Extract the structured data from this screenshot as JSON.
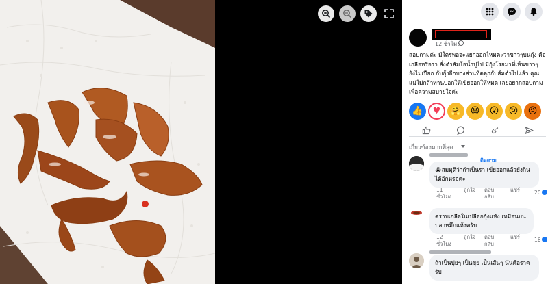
{
  "viewer": {
    "tools": [
      {
        "icon": "zoom-in-icon"
      },
      {
        "icon": "zoom-out-icon"
      },
      {
        "icon": "tag-icon"
      }
    ],
    "expand_icon": "expand-icon"
  },
  "topbar": {
    "icons": [
      "menu-grid-icon",
      "messenger-icon",
      "notifications-bell-icon"
    ]
  },
  "post": {
    "time": "12 ชั่วโมง",
    "caption": "สอบถามค่ะ มีใครพอจะแยกออกไหมคะว่าขาวๆบนกุ้ง คือเกลือหรือรา สั่งตำส้มโอน้ำปูไป มีกุ้งโรยมาที่เห็นขาวๆ ยังไม่เปียก กับกุ้งอีกบางส่วนที่คลุกกับส้มตำไปแล้ว คุณแม่ไม่กล้าทานบอกให้เขี่ยออกให้หมด เลยอยากสอบถามเพื่อความสบายใจค่ะ",
    "reactions": [
      "like",
      "love",
      "care",
      "haha",
      "wow",
      "sad",
      "angry"
    ],
    "actions": [
      "like-icon",
      "comment-icon",
      "share-icon",
      "send-icon"
    ]
  },
  "comments": {
    "sort_label": "เกี่ยวข้องมากที่สุด",
    "items": [
      {
        "follow": "ติดตาม",
        "text": "😭สมมุติว่าถ้าเป็นรา เขี่ยออกแล้วยังกินได้อีกหรอคะ",
        "time": "11 ชั่วโมง",
        "like": "ถูกใจ",
        "reply": "ตอบกลับ",
        "share": "แชร์",
        "count": "20"
      },
      {
        "text": "คราบเกลือในเปลือกกุ้งแห้ง เหมือนบนปลาหมึกแห้งครับ",
        "time": "12 ชั่วโมง",
        "like": "ถูกใจ",
        "reply": "ตอบกลับ",
        "share": "แชร์",
        "count": "16"
      },
      {
        "text": "ถ้าเป็นปุยๆ เป็นขุย เป็นเส้นๆ นั่นคือราครับ"
      }
    ]
  }
}
